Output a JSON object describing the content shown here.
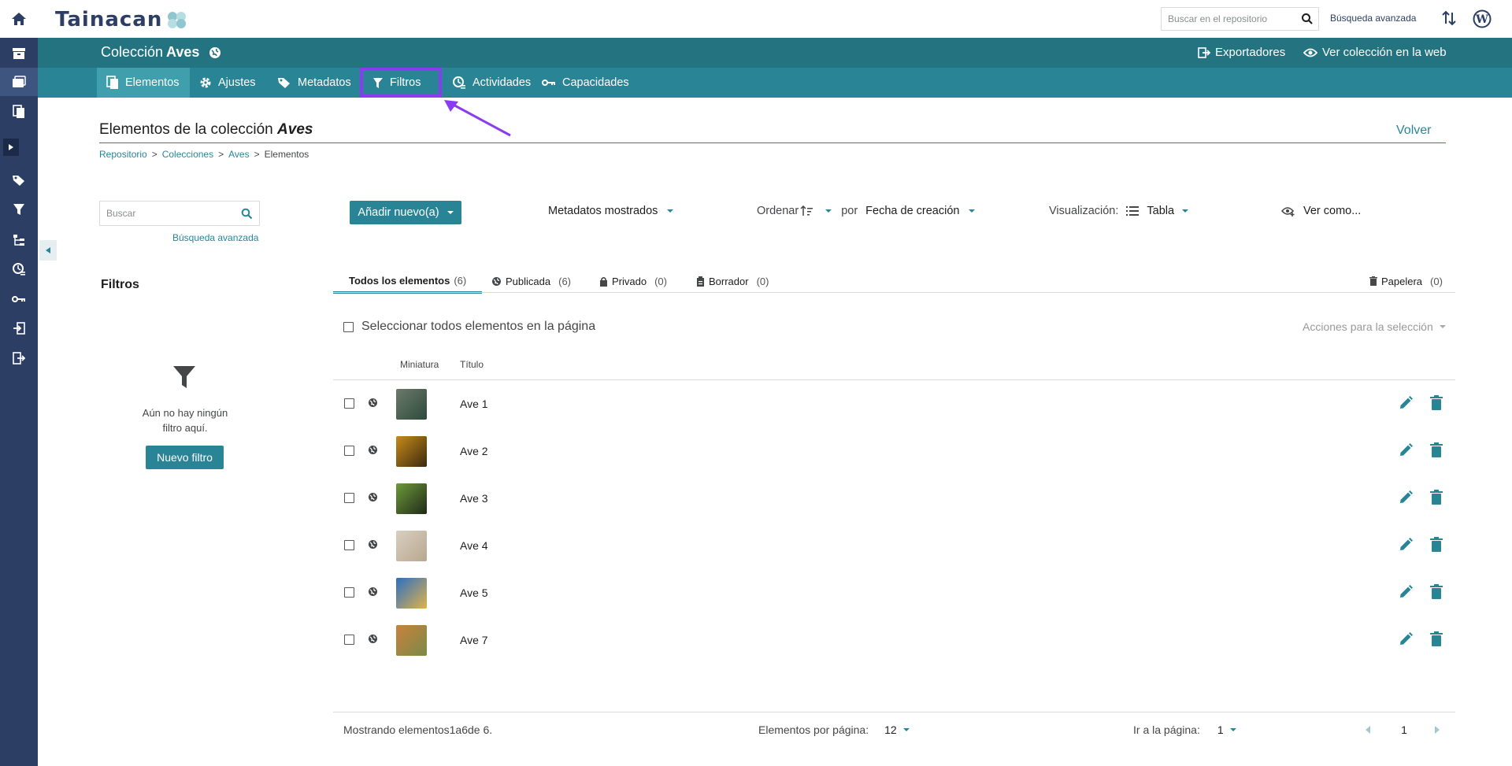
{
  "header": {
    "logo": "Tainacan",
    "search_placeholder": "Buscar en el repositorio",
    "advanced_search": "Búsqueda avanzada"
  },
  "collection_bar": {
    "prefix": "Colección",
    "name": "Aves",
    "exporters": "Exportadores",
    "view_web": "Ver colección en la web"
  },
  "tabs": [
    {
      "label": "Elementos",
      "icon": "items-icon",
      "active": true
    },
    {
      "label": "Ajustes",
      "icon": "gear-icon"
    },
    {
      "label": "Metadatos",
      "icon": "tags-icon"
    },
    {
      "label": "Filtros",
      "icon": "filter-icon",
      "highlighted": true
    },
    {
      "label": "Actividades",
      "icon": "activity-icon"
    },
    {
      "label": "Capacidades",
      "icon": "key-icon"
    }
  ],
  "page": {
    "title_prefix": "Elementos de la colección",
    "title_name": "Aves",
    "back": "Volver",
    "breadcrumbs": [
      "Repositorio",
      "Colecciones",
      "Aves",
      "Elementos"
    ]
  },
  "filters_panel": {
    "search_placeholder": "Buscar",
    "advanced_search": "Búsqueda avanzada",
    "title": "Filtros",
    "empty_text": "Aún no hay ningún filtro aquí.",
    "new_filter": "Nuevo filtro"
  },
  "toolbar": {
    "add_new": "Añadir nuevo(a)",
    "metadata_shown": "Metadatos mostrados",
    "order_label": "Ordenar",
    "by_label": "por",
    "order_field": "Fecha de creación",
    "view_label": "Visualización:",
    "view_mode": "Tabla",
    "view_as": "Ver como..."
  },
  "status_tabs": [
    {
      "label": "Todos los elementos",
      "count": "(6)",
      "active": true
    },
    {
      "label": "Publicada",
      "count": "(6)",
      "icon": "globe-icon"
    },
    {
      "label": "Privado",
      "count": "(0)",
      "icon": "lock-icon"
    },
    {
      "label": "Borrador",
      "count": "(0)",
      "icon": "clipboard-icon"
    },
    {
      "label": "Papelera",
      "count": "(0)",
      "icon": "trash-icon"
    }
  ],
  "selection": {
    "select_all": "Seleccionar todos elementos en la página",
    "actions": "Acciones para la selección"
  },
  "table": {
    "headers": [
      "Miniatura",
      "Título"
    ],
    "rows": [
      {
        "title": "Ave 1",
        "thumb_colors": [
          "#6b7a6a",
          "#2e4a3c"
        ]
      },
      {
        "title": "Ave 2",
        "thumb_colors": [
          "#c98a1a",
          "#3a2a10"
        ]
      },
      {
        "title": "Ave 3",
        "thumb_colors": [
          "#6e9a3a",
          "#1f2a18"
        ]
      },
      {
        "title": "Ave 4",
        "thumb_colors": [
          "#d9cfc0",
          "#b8a88f"
        ]
      },
      {
        "title": "Ave 5",
        "thumb_colors": [
          "#2b6fc4",
          "#e0b24a"
        ]
      },
      {
        "title": "Ave 7",
        "thumb_colors": [
          "#c9823a",
          "#7a8a4a"
        ]
      }
    ]
  },
  "footer": {
    "showing": "Mostrando elementos1a6de 6.",
    "per_page_label": "Elementos por página:",
    "per_page_value": "12",
    "goto_label": "Ir a la página:",
    "goto_value": "1",
    "current_page": "1"
  },
  "colors": {
    "rail": "#2c3e63",
    "collection_bar": "#247380",
    "tab_bar": "#298596",
    "accent": "#298596",
    "highlight": "#8a3cf0"
  }
}
